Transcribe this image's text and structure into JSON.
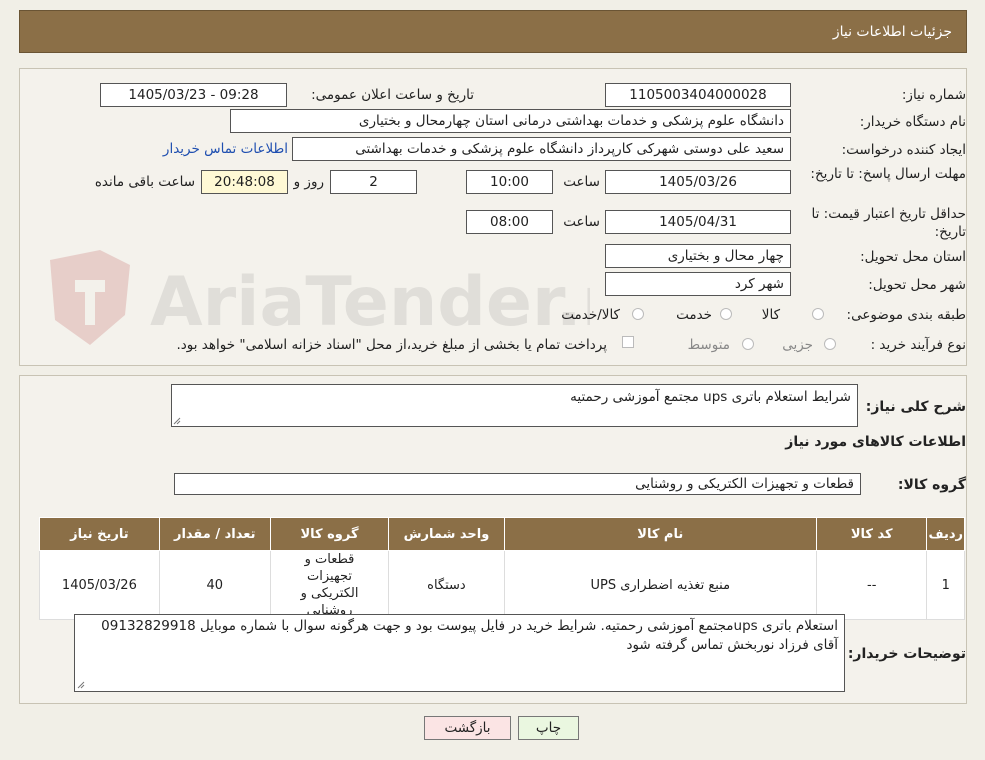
{
  "header": {
    "title": "جزئیات اطلاعات نیاز"
  },
  "form": {
    "need_number_label": "شماره نیاز:",
    "need_number": "1105003404000028",
    "announce_label": "تاریخ و ساعت اعلان عمومی:",
    "announce_value": "1405/03/23 - 09:28",
    "buyer_org_label": "نام دستگاه خریدار:",
    "buyer_org": "دانشگاه علوم پزشکی و خدمات بهداشتی درمانی استان چهارمحال و بختیاری",
    "creator_label": "ایجاد کننده درخواست:",
    "creator": "سعید علی دوستی شهرکی کارپرداز دانشگاه علوم پزشکی و خدمات بهداشتی",
    "contact_link": "اطلاعات تماس خریدار",
    "deadline_label": "مهلت ارسال پاسخ: تا تاریخ:",
    "deadline_date": "1405/03/26",
    "time_label": "ساعت",
    "deadline_time": "10:00",
    "days_value": "2",
    "days_label": "روز و",
    "remaining_time": "20:48:08",
    "remaining_label": "ساعت باقی مانده",
    "validity_label": "حداقل تاریخ اعتبار قیمت: تا تاریخ:",
    "validity_date": "1405/04/31",
    "validity_time": "08:00",
    "province_label": "استان محل تحویل:",
    "province": "چهار محال و بختیاری",
    "city_label": "شهر محل تحویل:",
    "city": "شهر کرد",
    "category_label": "طبقه بندی موضوعی:",
    "category_options": [
      "کالا",
      "خدمت",
      "کالا/خدمت"
    ],
    "process_label": "نوع فرآیند خرید :",
    "process_options": [
      "جزیی",
      "متوسط"
    ],
    "payment_note": "پرداخت تمام یا بخشی از مبلغ خرید،از محل \"اسناد خزانه اسلامی\" خواهد بود."
  },
  "description": {
    "label": "شرح کلی نیاز:",
    "value": "شرایط استعلام باتری ups مجتمع آموزشی رحمتیه",
    "goods_info_title": "اطلاعات کالاهای مورد نیاز",
    "group_label": "گروه کالا:",
    "group_value": "قطعات و تجهیزات الکتریکی و روشنایی"
  },
  "table": {
    "headers": [
      "ردیف",
      "کد کالا",
      "نام کالا",
      "واحد شمارش",
      "گروه کالا",
      "تعداد / مقدار",
      "تاریخ نیاز"
    ],
    "rows": [
      {
        "row": "1",
        "code": "--",
        "name": "منبع تغذیه اضطراری UPS",
        "unit": "دستگاه",
        "group": "قطعات و تجهیزات الکتریکی و روشنایی",
        "qty": "40",
        "date": "1405/03/26"
      }
    ]
  },
  "buyer_notes": {
    "label": "توضیحات خریدار:",
    "value": "استعلام باتری upsمجتمع آموزشی رحمتیه. شرایط خرید در فایل پیوست بود و جهت هرگونه سوال با شماره موبایل 09132829918 آقای فرزاد نوربخش تماس گرفته شود"
  },
  "buttons": {
    "print": "چاپ",
    "back": "بازگشت"
  },
  "watermark": {
    "text": "AriaTender.neT"
  }
}
